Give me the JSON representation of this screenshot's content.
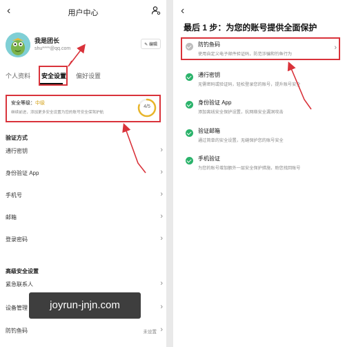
{
  "left": {
    "header": {
      "back": "‹",
      "title": "用户中心",
      "user_icon": "user-settings-icon"
    },
    "profile": {
      "name": "我是团长",
      "email": "shu****@qq.com",
      "edit": "编辑"
    },
    "tabs": [
      "个人资料",
      "安全设置",
      "偏好设置"
    ],
    "security": {
      "level_label": "安全等级：",
      "level_value": "中级",
      "desc": "继续前进，添加更多安全设置为您的账号安全保驾护航",
      "score": "4/5",
      "progress": 0.8
    },
    "verify": {
      "title": "验证方式",
      "items": [
        "通行密钥",
        "身份验证 App",
        "手机号",
        "邮箱",
        "登录密码"
      ]
    },
    "advanced": {
      "title": "高级安全设置",
      "items": [
        {
          "label": "紧急联系人",
          "status": ""
        },
        {
          "label": "设备管理",
          "status": ""
        },
        {
          "label": "防钓鱼码",
          "status": "未设置"
        }
      ]
    },
    "watermark": "joyrun-jnjn.com"
  },
  "right": {
    "back": "‹",
    "title": "最后 1 步：为您的账号提供全面保护",
    "items": [
      {
        "name": "防钓鱼码",
        "desc": "使用自定义电子邮件验证码，防范诈骗和钓鱼行为",
        "done": false
      },
      {
        "name": "通行密钥",
        "desc": "无需密码或验证码，轻松登录您的账号，提升账号安全",
        "done": true
      },
      {
        "name": "身份验证 App",
        "desc": "添加离线安全保护设置，抗网络安全漏洞攻击",
        "done": true
      },
      {
        "name": "验证邮箱",
        "desc": "通过简单的安全设置，无缝保护您的账号安全",
        "done": true
      },
      {
        "name": "手机验证",
        "desc": "为您的账号增加额外一层安全保护措施，助您找回账号",
        "done": true
      }
    ]
  },
  "colors": {
    "accent_red": "#d9323a",
    "level_gold": "#d4a015",
    "check_green": "#2bb36b"
  }
}
